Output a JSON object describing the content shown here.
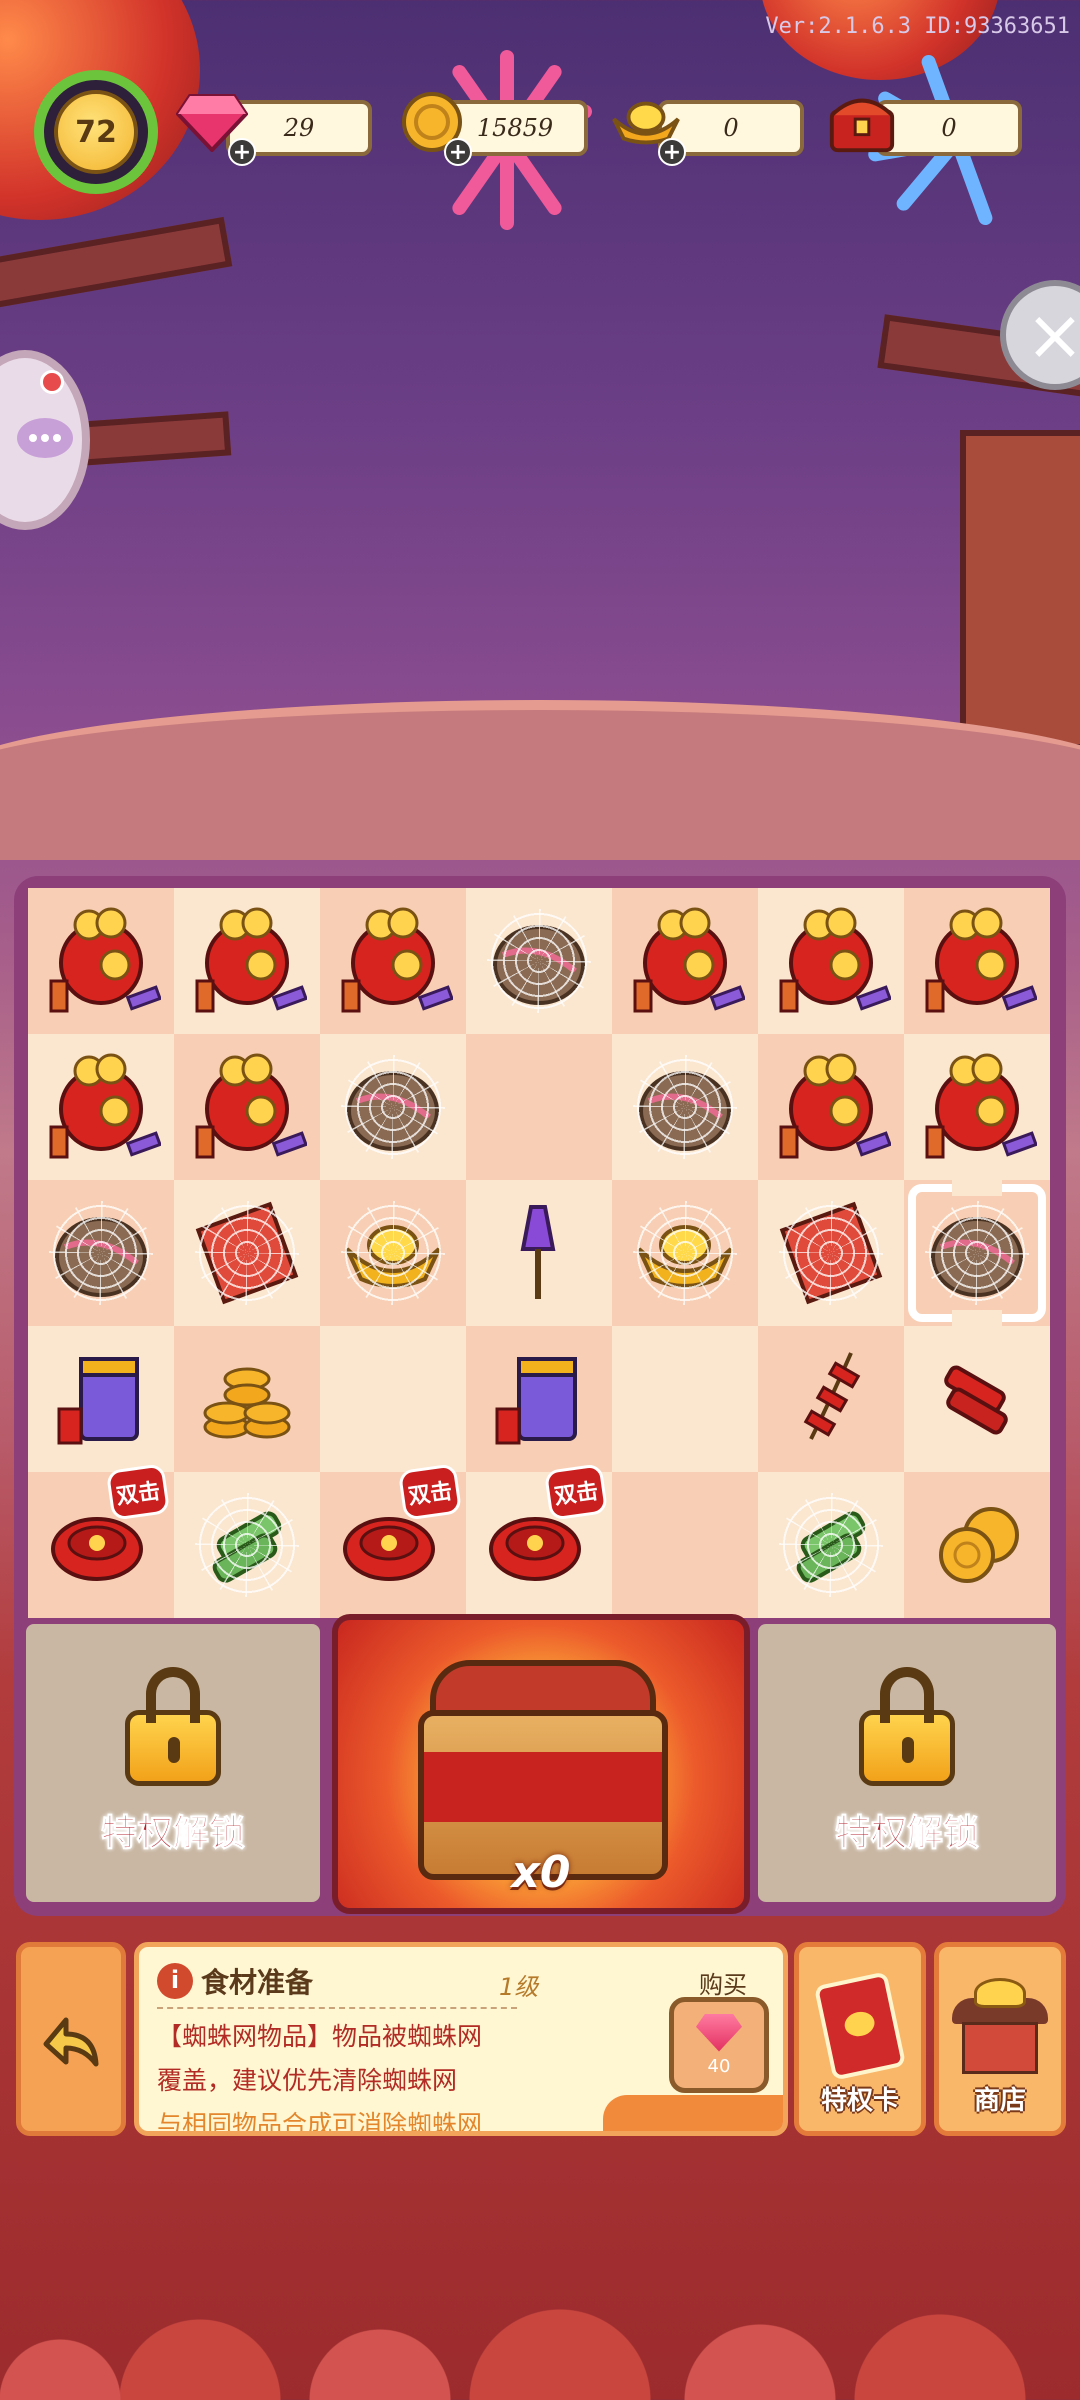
{
  "header": {
    "version": "Ver:2.1.6.3 ID:93363651",
    "level": "72",
    "resources": [
      {
        "name": "gems",
        "icon": "gem-icon",
        "value": "29"
      },
      {
        "name": "coins",
        "icon": "coin-icon",
        "value": "15859"
      },
      {
        "name": "gold-ingot",
        "icon": "gold-ingot-icon",
        "value": "0"
      },
      {
        "name": "chest",
        "icon": "treasure-chest-icon",
        "value": "0"
      }
    ]
  },
  "board": {
    "rows": [
      [
        "lucky-bag",
        "lucky-bag",
        "lucky-bag",
        "webbed-item",
        "lucky-bag",
        "lucky-bag",
        "lucky-bag"
      ],
      [
        "lucky-bag",
        "lucky-bag",
        "webbed-item",
        "",
        "webbed-item",
        "lucky-bag",
        "lucky-bag"
      ],
      [
        "webbed-item",
        "webbed-red-envelope",
        "webbed-gold",
        "rocket",
        "webbed-gold",
        "webbed-red-envelope",
        "webbed-item"
      ],
      [
        "firework-box",
        "coin-stack",
        "",
        "firework-box",
        "",
        "firecracker-string",
        "firecracker"
      ],
      [
        "firecracker-roll",
        "webbed-bamboo",
        "firecracker-roll",
        "firecracker-roll",
        "",
        "webbed-bamboo",
        "coins"
      ]
    ],
    "double_badge": "双击",
    "selected_cell": [
      2,
      6
    ]
  },
  "locked_slots": {
    "label": "特权解锁"
  },
  "chest": {
    "count": "x0"
  },
  "info": {
    "title": "食材准备",
    "level": "1级",
    "buy_label": "购买",
    "line1": "【蜘蛛网物品】物品被蜘蛛网",
    "line2": "覆盖，建议优先清除蜘蛛网",
    "line3": "与相同物品合成可消除蜘蛛网",
    "price": "40"
  },
  "buttons": {
    "privilege_card": "特权卡",
    "shop": "商店"
  },
  "colors": {
    "accent_red": "#c8231f",
    "panel_cream": "#fff6d2",
    "board_purple": "#8d3f7a",
    "level_ring": "#6bc43b"
  }
}
